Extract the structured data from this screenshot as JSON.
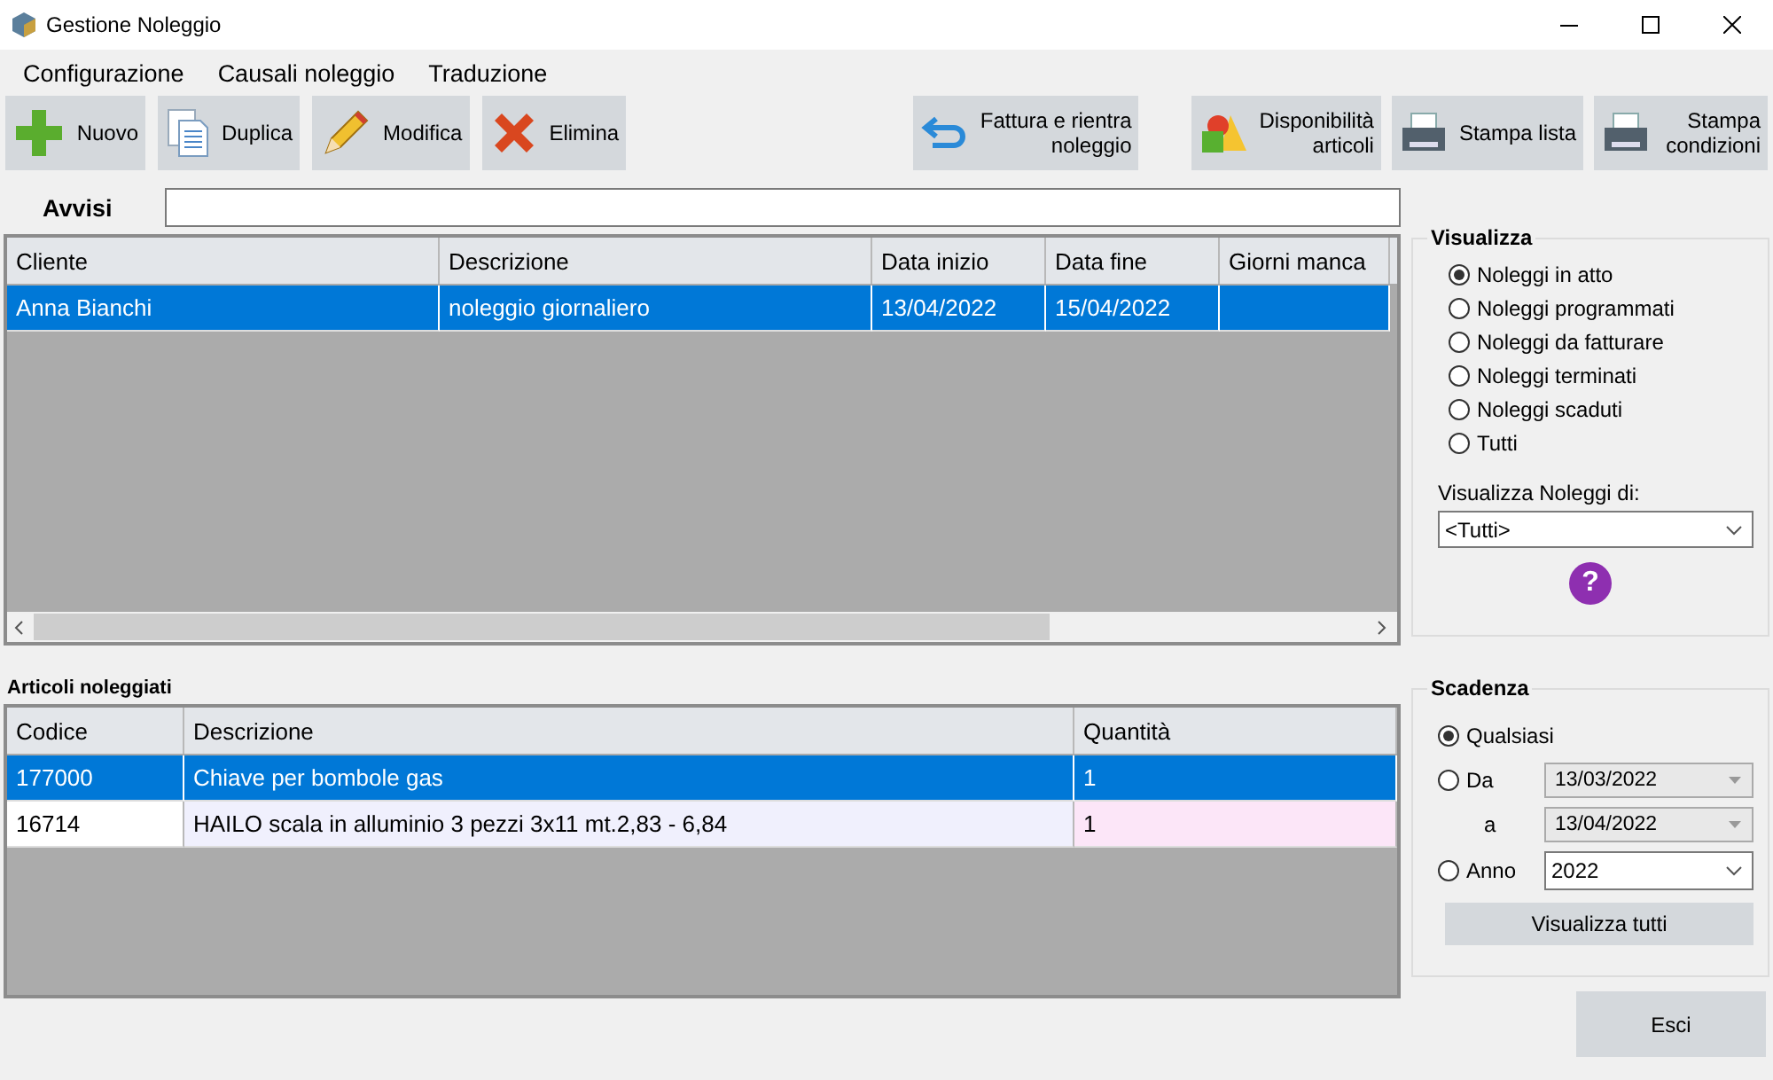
{
  "window": {
    "title": "Gestione Noleggio"
  },
  "menu": [
    {
      "label": "Configurazione"
    },
    {
      "label": "Causali noleggio"
    },
    {
      "label": "Traduzione"
    }
  ],
  "toolbar_left": [
    {
      "label": "Nuovo"
    },
    {
      "label": "Duplica"
    },
    {
      "label": "Modifica"
    },
    {
      "label": "Elimina"
    }
  ],
  "toolbar_right": [
    {
      "label": "Fattura e rientra\nnoleggio"
    },
    {
      "label": "Disponibilità\narticoli"
    },
    {
      "label": "Stampa lista"
    },
    {
      "label": "Stampa\ncondizioni"
    }
  ],
  "avvisi": {
    "label": "Avvisi"
  },
  "noleggi_table": {
    "columns": [
      "Cliente",
      "Descrizione",
      "Data inizio",
      "Data fine",
      "Giorni manca"
    ],
    "rows": [
      {
        "cells": [
          "Anna Bianchi",
          "noleggio giornaliero",
          "13/04/2022",
          "15/04/2022",
          ""
        ],
        "selected": true
      }
    ]
  },
  "articoli": {
    "title": "Articoli noleggiati",
    "columns": [
      "Codice",
      "Descrizione",
      "Quantità"
    ],
    "rows": [
      {
        "cells": [
          "177000",
          "Chiave per bombole gas",
          "1"
        ],
        "selected": true
      },
      {
        "cells": [
          "16714",
          "HAILO scala in alluminio 3 pezzi 3x11 mt.2,83 - 6,84",
          "1"
        ],
        "selected": false
      }
    ]
  },
  "visualizza": {
    "title": "Visualizza",
    "options": [
      {
        "label": "Noleggi in atto",
        "selected": true
      },
      {
        "label": "Noleggi programmati",
        "selected": false
      },
      {
        "label": "Noleggi da fatturare",
        "selected": false
      },
      {
        "label": "Noleggi terminati",
        "selected": false
      },
      {
        "label": "Noleggi scaduti",
        "selected": false
      },
      {
        "label": "Tutti",
        "selected": false
      }
    ],
    "filter_label": "Visualizza Noleggi di:",
    "filter_value": "<Tutti>",
    "help": "?"
  },
  "scadenza": {
    "title": "Scadenza",
    "any": {
      "label": "Qualsiasi",
      "selected": true
    },
    "range": {
      "label": "Da",
      "selected": false,
      "disabled": true,
      "from": "13/03/2022",
      "to_label": "a",
      "to": "13/04/2022"
    },
    "year": {
      "label": "Anno",
      "selected": false,
      "value": "2022"
    },
    "button": "Visualizza tutti"
  },
  "exit_button": "Esci"
}
